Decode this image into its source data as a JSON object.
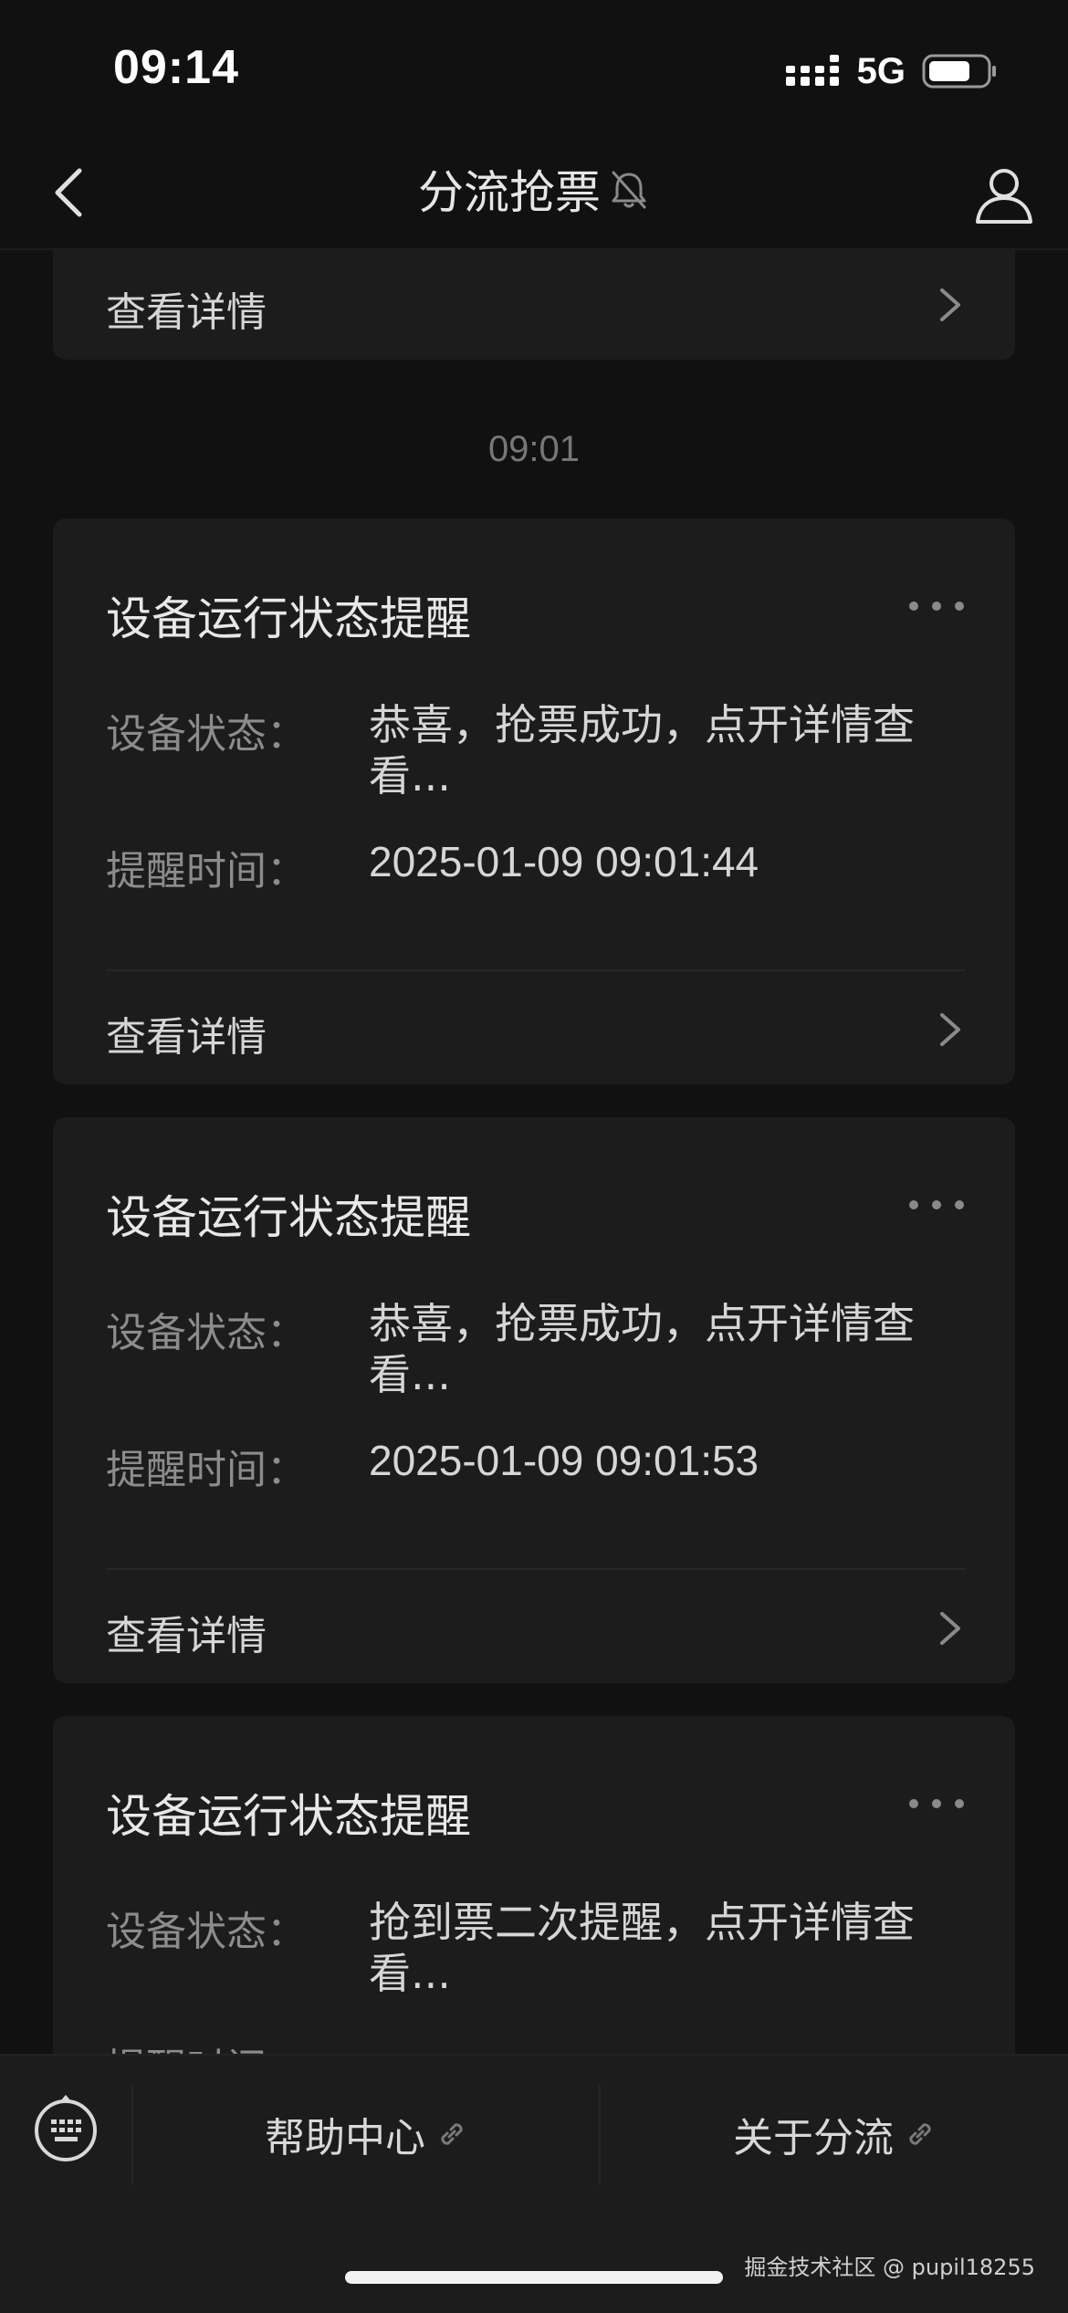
{
  "status_bar": {
    "time": "09:14",
    "network": "5G"
  },
  "nav": {
    "title": "分流抢票",
    "back_icon": "chevron-left-icon",
    "mute_icon": "bell-off-icon",
    "profile_icon": "user-icon"
  },
  "partial_card": {
    "detail_label": "查看详情"
  },
  "timestamp": "09:01",
  "cards": [
    {
      "title": "设备运行状态提醒",
      "status_label": "设备状态：",
      "status_value": "恭喜，抢票成功，点开详情查看...",
      "time_label": "提醒时间：",
      "time_value": "2025-01-09 09:01:44",
      "detail_label": "查看详情"
    },
    {
      "title": "设备运行状态提醒",
      "status_label": "设备状态：",
      "status_value": "恭喜，抢票成功，点开详情查看...",
      "time_label": "提醒时间：",
      "time_value": "2025-01-09 09:01:53",
      "detail_label": "查看详情"
    },
    {
      "title": "设备运行状态提醒",
      "status_label": "设备状态：",
      "status_value": "抢到票二次提醒，点开详情查看...",
      "time_label": "提醒时间："
    }
  ],
  "bottom_menu": {
    "keyboard_icon": "keyboard-icon",
    "items": [
      {
        "label": "帮助中心",
        "icon": "link-icon"
      },
      {
        "label": "关于分流",
        "icon": "link-icon"
      }
    ]
  },
  "watermark": "掘金技术社区 @ pupil18255"
}
